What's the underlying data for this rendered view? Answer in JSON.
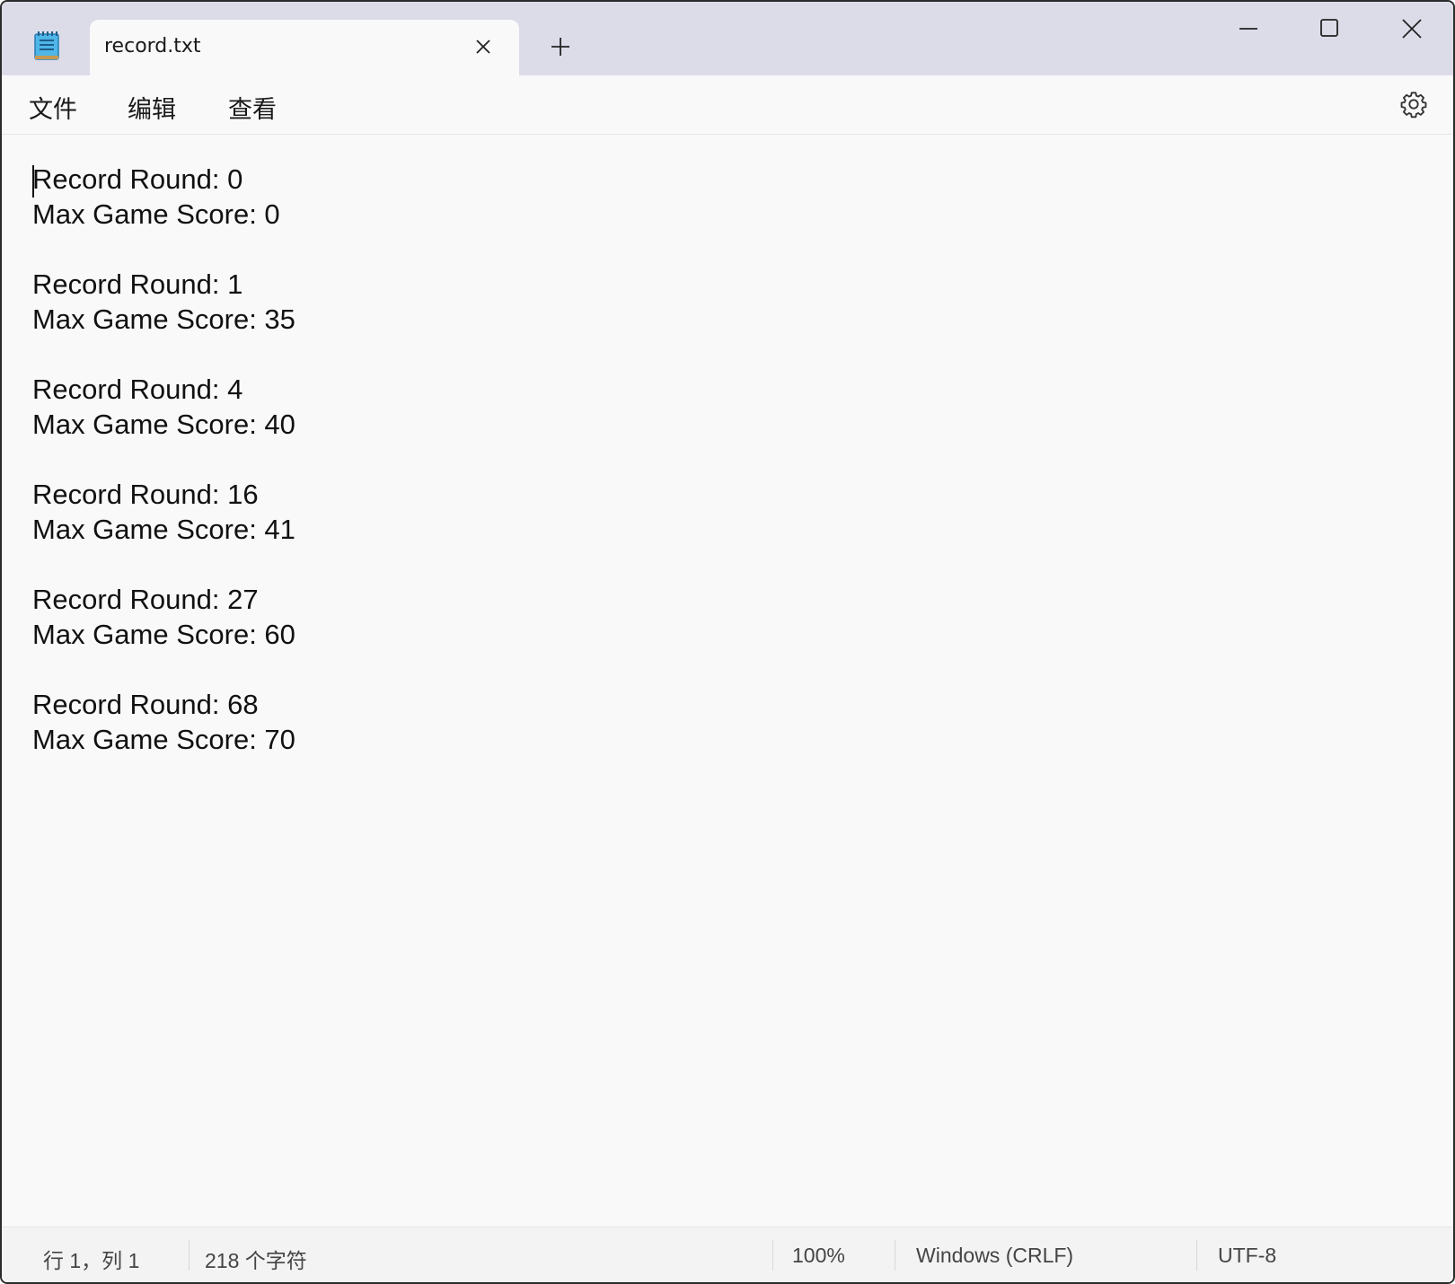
{
  "window": {
    "tab_title": "record.txt"
  },
  "menu": {
    "file": "文件",
    "edit": "编辑",
    "view": "查看"
  },
  "editor": {
    "content": "Record Round: 0\nMax Game Score: 0\n\nRecord Round: 1\nMax Game Score: 35\n\nRecord Round: 4\nMax Game Score: 40\n\nRecord Round: 16\nMax Game Score: 41\n\nRecord Round: 27\nMax Game Score: 60\n\nRecord Round: 68\nMax Game Score: 70"
  },
  "status": {
    "position": "行 1，列 1",
    "chars": "218 个字符",
    "zoom": "100%",
    "line_ending": "Windows (CRLF)",
    "encoding": "UTF-8"
  },
  "icons": {
    "app": "notepad-icon",
    "tab_close": "close-icon",
    "new_tab": "plus-icon",
    "minimize": "minimize-icon",
    "maximize": "maximize-icon",
    "close": "close-icon",
    "settings": "gear-icon"
  },
  "colors": {
    "titlebar": "#dcdce9",
    "background": "#f9f9f9",
    "statusbar": "#f3f3f3"
  }
}
